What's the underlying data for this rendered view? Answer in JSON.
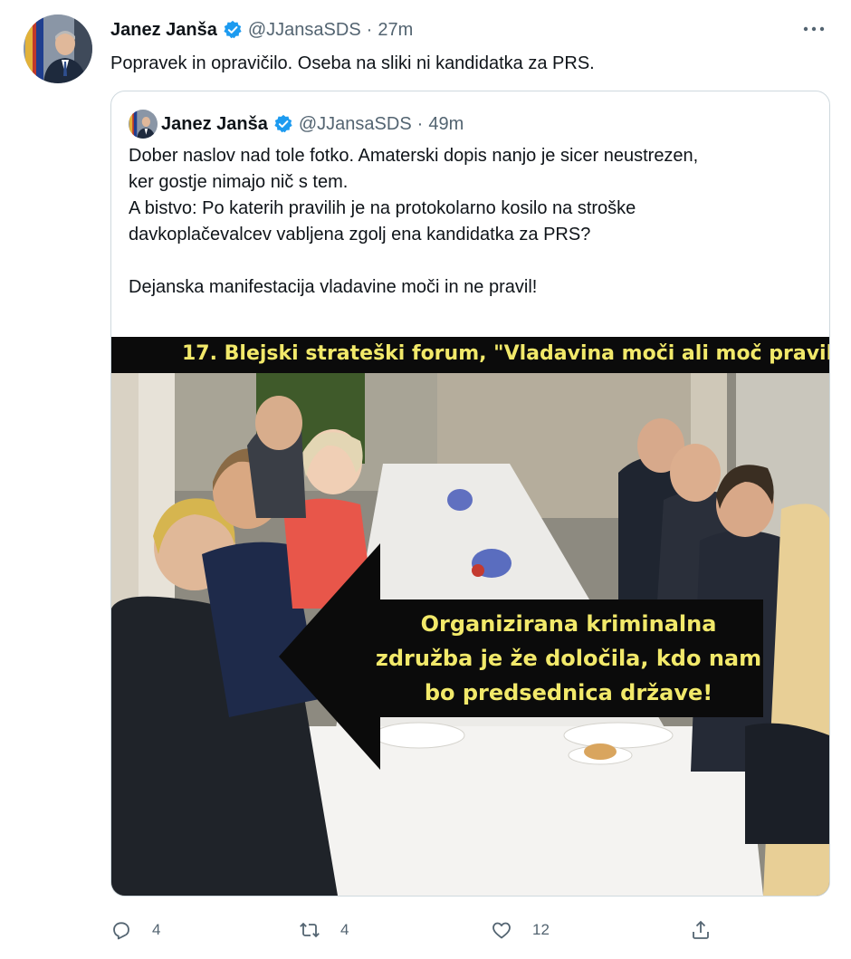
{
  "tweet": {
    "author_name": "Janez Janša",
    "handle": "@JJansaSDS",
    "separator": "·",
    "time": "27m",
    "text": "Popravek in opravičilo. Oseba na sliki ni kandidatka za PRS.",
    "more_icon": "more-icon"
  },
  "quote": {
    "author_name": "Janez Janša",
    "handle": "@JJansaSDS",
    "separator": "·",
    "time": "49m",
    "lines": [
      "Dober naslov nad tole fotko. Amaterski dopis nanjo je sicer neustrezen,",
      "ker gostje nimajo nič s tem.",
      "A bistvo: Po katerih pravilih je na protokolarno kosilo na stroške",
      "davkoplačevalcev vabljena zgolj ena kandidatka za PRS?",
      "",
      "Dejanska manifestacija vladavine moči in ne pravil!"
    ],
    "image": {
      "banner_text": "17. Blejski strateški forum, \"Vladavina moči ali moč pravil",
      "caption_lines": [
        "Organizirana kriminalna",
        "združba je že določila, kdo nam",
        "bo predsednica države!"
      ]
    }
  },
  "actions": {
    "reply_count": "4",
    "retweet_count": "4",
    "like_count": "12"
  },
  "colors": {
    "verified": "#1d9bf0",
    "secondary_text": "#536471",
    "caption_text": "#f2e96a",
    "border": "#cfd9de"
  }
}
